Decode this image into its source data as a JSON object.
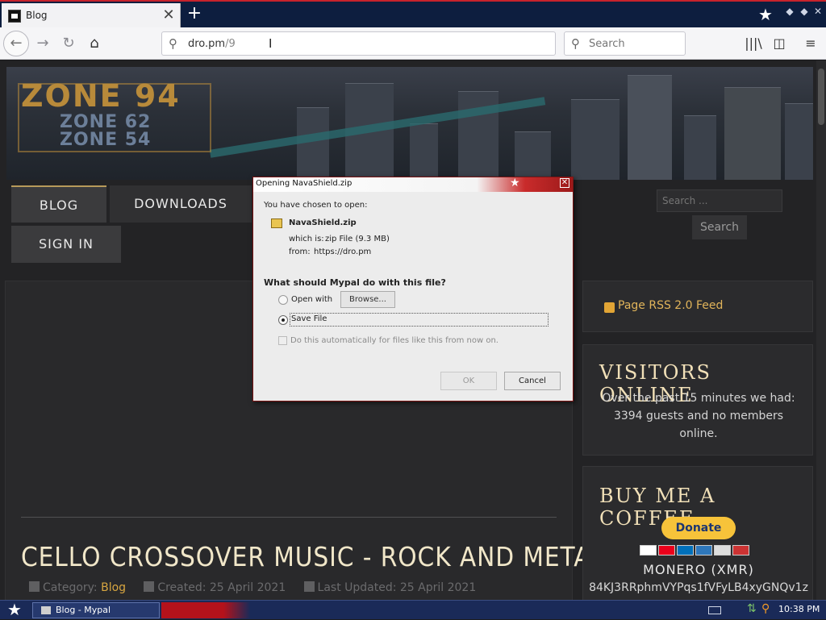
{
  "browser": {
    "tab_title": "Blog",
    "new_tab_label": "+",
    "url_host": "dro.pm",
    "url_path": "/9",
    "search_placeholder": "Search"
  },
  "site": {
    "logo_main": "ZONE 94",
    "logo_sub1": "ZONE 62",
    "logo_sub2": "ZONE 54",
    "menu": {
      "blog": "BLOG",
      "downloads": "DOWNLOADS",
      "sign_in": "SIGN IN"
    },
    "search": {
      "placeholder": "Search ...",
      "button": "Search"
    }
  },
  "post": {
    "title": "CELLO CROSSOVER MUSIC - ROCK AND METAL",
    "category_label": "Category:",
    "category": "Blog",
    "created": "Created: 25 April 2021",
    "updated": "Last Updated: 25 April 2021"
  },
  "sidebar": {
    "rss": "Page RSS 2.0 Feed",
    "visitors": {
      "heading": "VISITORS ONLINE",
      "text": "Over the past 15 minutes we had: 3394 guests and no members online."
    },
    "coffee": {
      "heading": "BUY ME A COFFEE",
      "donate": "Donate",
      "coin": "MONERO (XMR)",
      "address": "84KJ3RRphmVYPqs1fVFyLB4xyGNQv1z"
    }
  },
  "dialog": {
    "title": "Opening NavaShield.zip",
    "chosen": "You have chosen to open:",
    "filename": "NavaShield.zip",
    "which_is_label": "which is:",
    "which_is": "zip File (9.3 MB)",
    "from_label": "from:",
    "from": "https://dro.pm",
    "question": "What should Mypal do with this file?",
    "open_with": "Open with",
    "browse": "Browse...",
    "save_file": "Save File",
    "auto": "Do this automatically for files like this from now on.",
    "ok": "OK",
    "cancel": "Cancel"
  },
  "taskbar": {
    "window": "Blog - Mypal",
    "clock": "10:38 PM"
  }
}
